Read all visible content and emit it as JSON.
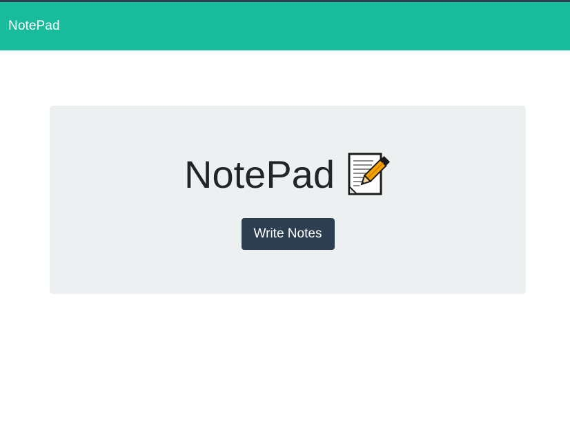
{
  "navbar": {
    "brand": "NotePad",
    "bg_color": "#18bc9c"
  },
  "hero": {
    "title": "NotePad",
    "icon": "memo-icon",
    "button_label": "Write Notes",
    "button_color": "#2c3e50",
    "panel_color": "#ecf0f1"
  }
}
